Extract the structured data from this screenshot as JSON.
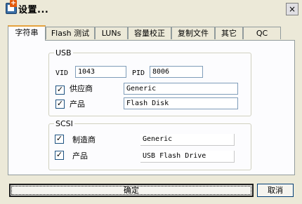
{
  "window": {
    "title": "设置..."
  },
  "icons": {
    "app": "app-settings-icon",
    "close": "close-icon"
  },
  "title_bar": {
    "close_glyph": "×"
  },
  "tabs": [
    {
      "label": "字符串",
      "active": true
    },
    {
      "label": "Flash 测试",
      "active": false
    },
    {
      "label": "LUNs",
      "active": false
    },
    {
      "label": "容量校正",
      "active": false
    },
    {
      "label": "复制文件",
      "active": false
    },
    {
      "label": "其它",
      "active": false
    },
    {
      "label": "QC",
      "active": false
    }
  ],
  "usb": {
    "group_label": "USB",
    "vid_label": "VID",
    "vid_value": "1043",
    "pid_label": "PID",
    "pid_value": "8006",
    "vendor": {
      "label": "供应商",
      "checked": true,
      "value": "Generic"
    },
    "product": {
      "label": "产品",
      "checked": true,
      "value": "Flash Disk"
    }
  },
  "scsi": {
    "group_label": "SCSI",
    "manufacturer": {
      "label": "制造商",
      "checked": true,
      "value": "Generic"
    },
    "product": {
      "label": "产品",
      "checked": true,
      "value": "USB Flash Drive"
    }
  },
  "buttons": {
    "ok": "确定",
    "cancel": "取消"
  },
  "check_glyph": "✓"
}
